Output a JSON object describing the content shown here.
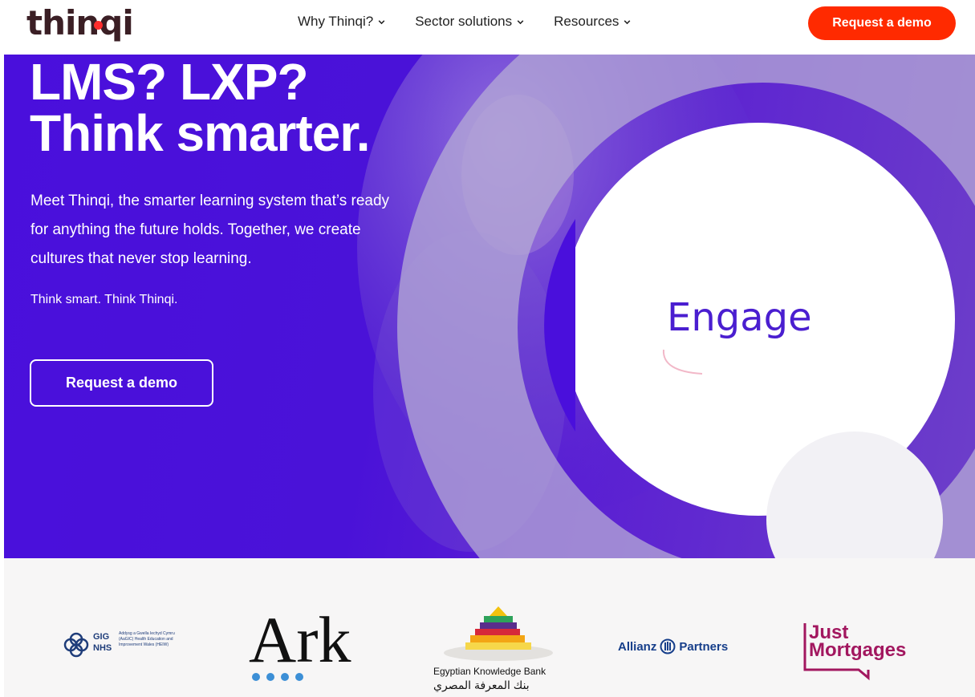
{
  "nav": {
    "logo": "thinqi",
    "links": [
      {
        "label": "Why Thinqi?"
      },
      {
        "label": "Sector solutions"
      },
      {
        "label": "Resources"
      }
    ],
    "cta": "Request a demo"
  },
  "hero": {
    "headline_line1": "LMS? LXP?",
    "headline_line2": "Think smarter.",
    "intro": "Meet Thinqi, the smarter learning system that’s ready for anything the future holds. Together, we create cultures that never stop learning.",
    "tagline": "Think smart. Think Thinqi.",
    "cta": "Request a demo",
    "animated_word": "Engage"
  },
  "clients": {
    "gig": {
      "line1": "GIG",
      "line2": "NHS",
      "small": "Addysg a Gwella Iechyd Cymru (AaGIC) Health Education and Improvement Wales (HEIW)"
    },
    "ark": {
      "name": "Ark"
    },
    "ekb": {
      "english": "Egyptian Knowledge Bank",
      "arabic": "بنك المعرفة المصري"
    },
    "allianz": {
      "name": "Allianz",
      "suffix": "Partners"
    },
    "just_mortgages": {
      "line1": "Just",
      "line2": "Mortgages"
    }
  },
  "colors": {
    "brand_red": "#ff2a00",
    "hero_purple": "#4a0fdc",
    "logo_dark": "#3b1f25"
  }
}
